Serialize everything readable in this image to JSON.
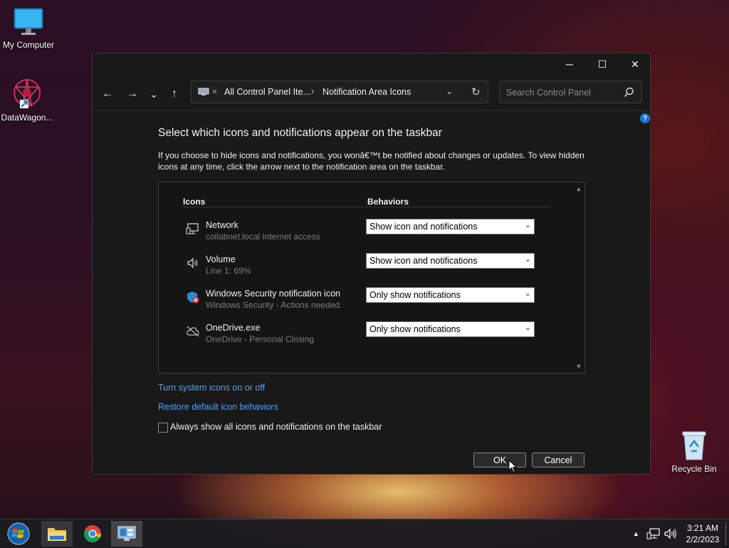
{
  "desktop": {
    "icons": [
      {
        "label": "My Computer"
      },
      {
        "label": "DataWagon..."
      },
      {
        "label": "Recycle Bin"
      }
    ]
  },
  "window": {
    "controls": {
      "minimize": "─",
      "maximize": "☐",
      "close": "✕"
    },
    "nav": {
      "back": "←",
      "forward": "→",
      "recent": "⌄",
      "up": "↑"
    },
    "address": {
      "overflow": "«",
      "crumb1": "All Control Panel Ite...",
      "separator": "›",
      "crumb2": "Notification Area Icons",
      "dropdown": "⌄",
      "refresh": "↻"
    },
    "search": {
      "placeholder": "Search Control Panel",
      "icon": "search-icon"
    },
    "help": "?",
    "heading": "Select which icons and notifications appear on the taskbar",
    "description": "If you choose to hide icons and notifications, you wonâ€™t be notified about changes or updates. To view hidden icons at any time, click the arrow next to the notification area on the taskbar.",
    "table": {
      "col_icons": "Icons",
      "col_behaviors": "Behaviors",
      "rows": [
        {
          "name": "Network",
          "sub": "collabnet.local Internet access",
          "behavior": "Show icon and notifications",
          "icon": "network-icon"
        },
        {
          "name": "Volume",
          "sub": "Line 1: 69%",
          "behavior": "Show icon and notifications",
          "icon": "speaker-icon"
        },
        {
          "name": "Windows Security notification icon",
          "sub": "Windows Security - Actions needed.",
          "behavior": "Only show notifications",
          "icon": "shield-icon"
        },
        {
          "name": "OneDrive.exe",
          "sub": "OneDrive - Personal Closing",
          "behavior": "Only show notifications",
          "icon": "cloud-off-icon"
        }
      ]
    },
    "links": {
      "system_icons": "Turn system icons on or off",
      "restore": "Restore default icon behaviors"
    },
    "checkbox": {
      "label": "Always show all icons and notifications on the taskbar",
      "checked": false
    },
    "buttons": {
      "ok": "OK",
      "cancel": "Cancel"
    }
  },
  "taskbar": {
    "time": "3:21 AM",
    "date": "2/2/2023",
    "chevron": "▲"
  },
  "colors": {
    "accent_link": "#4aa3f5",
    "window_bg": "#191919",
    "help_blue": "#1a73d6"
  }
}
